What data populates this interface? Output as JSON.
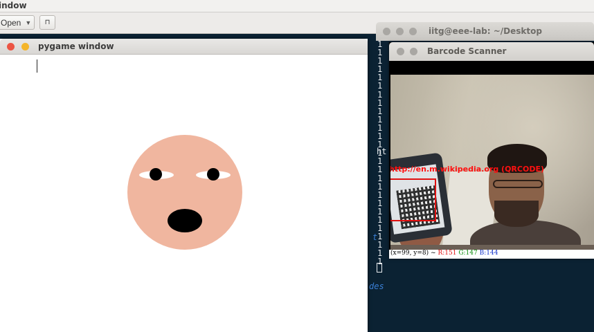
{
  "background_window": {
    "title_fragment": "indow",
    "toolbar": {
      "open_label": "Open",
      "pin_glyph": "⊓"
    }
  },
  "terminal": {
    "title": "iitg@eee-lab: ~/Desktop",
    "output_lines": [
      "1",
      "1",
      "1",
      "1",
      "1",
      "1",
      "1",
      "1",
      "1",
      "1",
      "1",
      "1",
      "1",
      "1",
      "1",
      "1",
      "1",
      "1",
      "1",
      "1",
      "1",
      "1",
      "1",
      "1",
      "1",
      "1",
      "1"
    ],
    "frag_ht": "ht",
    "frag_t": "t",
    "frag_des": "des"
  },
  "scanner": {
    "title": "Barcode Scanner",
    "decoded_text": "http://en.m.wikipedia.org (QRCODE)",
    "status": {
      "coords": "(x=99, y=8) ~",
      "r": "R:151",
      "g": "G:147",
      "b": "B:144"
    }
  },
  "pygame": {
    "title": "pygame window",
    "face": {
      "skin_color": "#f0b69f",
      "eye_white": "#ffffff",
      "pupil_color": "#000000",
      "mouth_color": "#000000"
    }
  },
  "colors": {
    "terminal_bg": "#0b2233",
    "close_red": "#ec5544",
    "minimize_yellow": "#f4b52a",
    "detection_red": "#e01010"
  }
}
